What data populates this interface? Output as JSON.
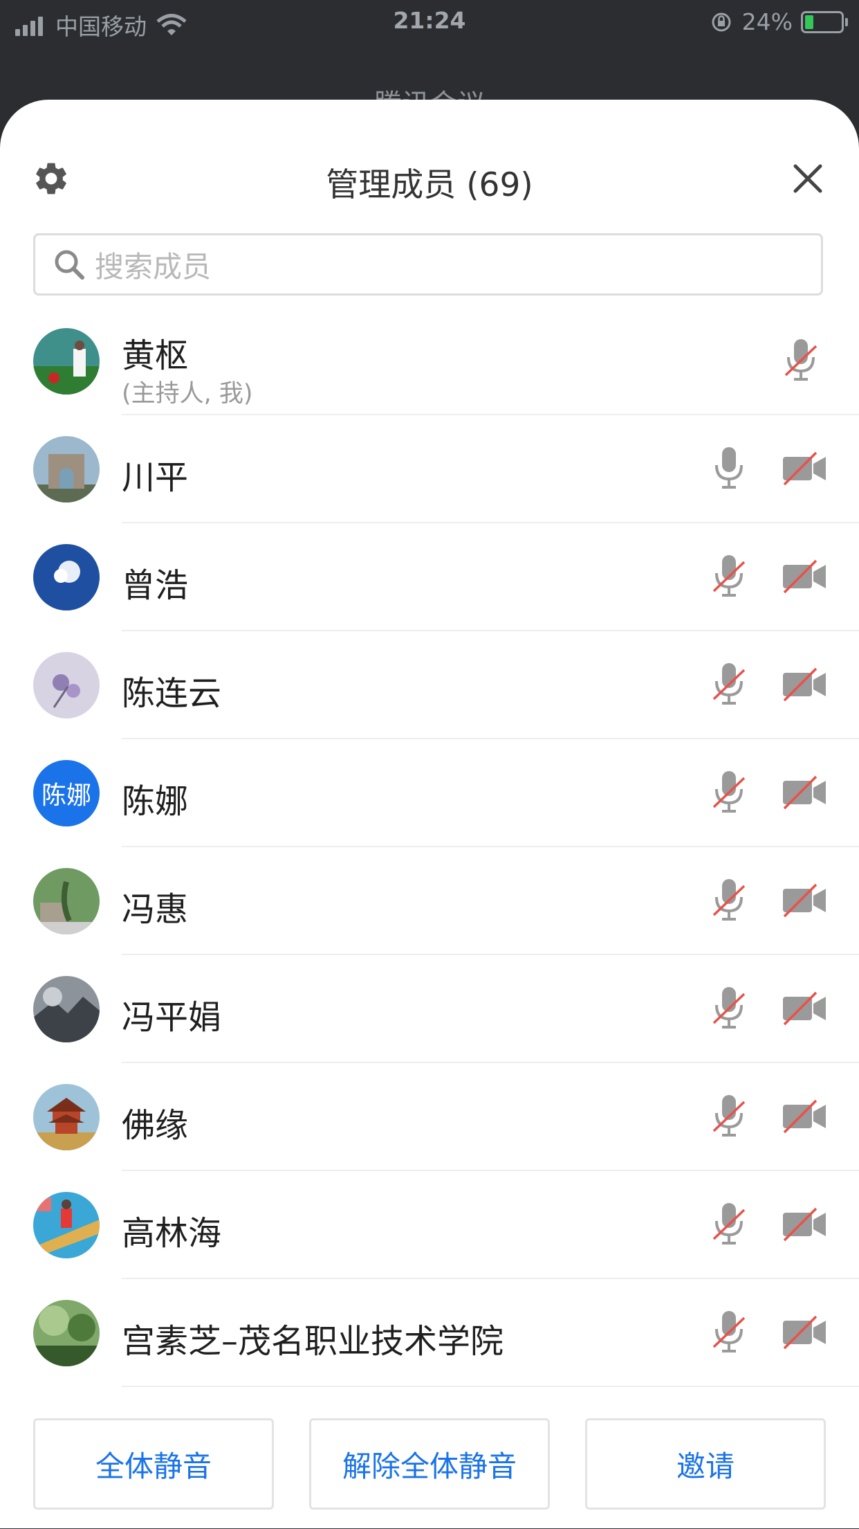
{
  "status_bar": {
    "carrier": "中国移动",
    "time": "21:24",
    "battery": "24%",
    "battery_level": 0.24
  },
  "background_title": "腾讯会议",
  "sheet": {
    "title": "管理成员 (69)",
    "search_placeholder": "搜索成员"
  },
  "colors": {
    "accent": "#1a73e8",
    "muted_slash": "#e8524a",
    "icon_gray": "#9a9a9a"
  },
  "members": [
    {
      "name": "黄枢",
      "role": "(主持人, 我)",
      "avatar": "photo-landscape-person",
      "mic": "muted",
      "camera": "none"
    },
    {
      "name": "川平",
      "role": "",
      "avatar": "photo-arch",
      "mic": "on",
      "camera": "off"
    },
    {
      "name": "曾浩",
      "role": "",
      "avatar": "photo-sky",
      "mic": "muted",
      "camera": "off"
    },
    {
      "name": "陈连云",
      "role": "",
      "avatar": "photo-flowers",
      "mic": "muted",
      "camera": "off"
    },
    {
      "name": "陈娜",
      "role": "",
      "avatar_text": "陈娜",
      "mic": "muted",
      "camera": "off"
    },
    {
      "name": "冯惠",
      "role": "",
      "avatar": "photo-garden",
      "mic": "muted",
      "camera": "off"
    },
    {
      "name": "冯平娟",
      "role": "",
      "avatar": "photo-mountain",
      "mic": "muted",
      "camera": "off"
    },
    {
      "name": "佛缘",
      "role": "",
      "avatar": "photo-pavilion",
      "mic": "muted",
      "camera": "off"
    },
    {
      "name": "高林海",
      "role": "",
      "avatar": "photo-child-pool",
      "mic": "muted",
      "camera": "off"
    },
    {
      "name": "宫素芝–茂名职业技术学院",
      "role": "",
      "avatar": "photo-forest",
      "mic": "muted",
      "camera": "off"
    }
  ],
  "footer": {
    "mute_all": "全体静音",
    "unmute_all": "解除全体静音",
    "invite": "邀请"
  }
}
